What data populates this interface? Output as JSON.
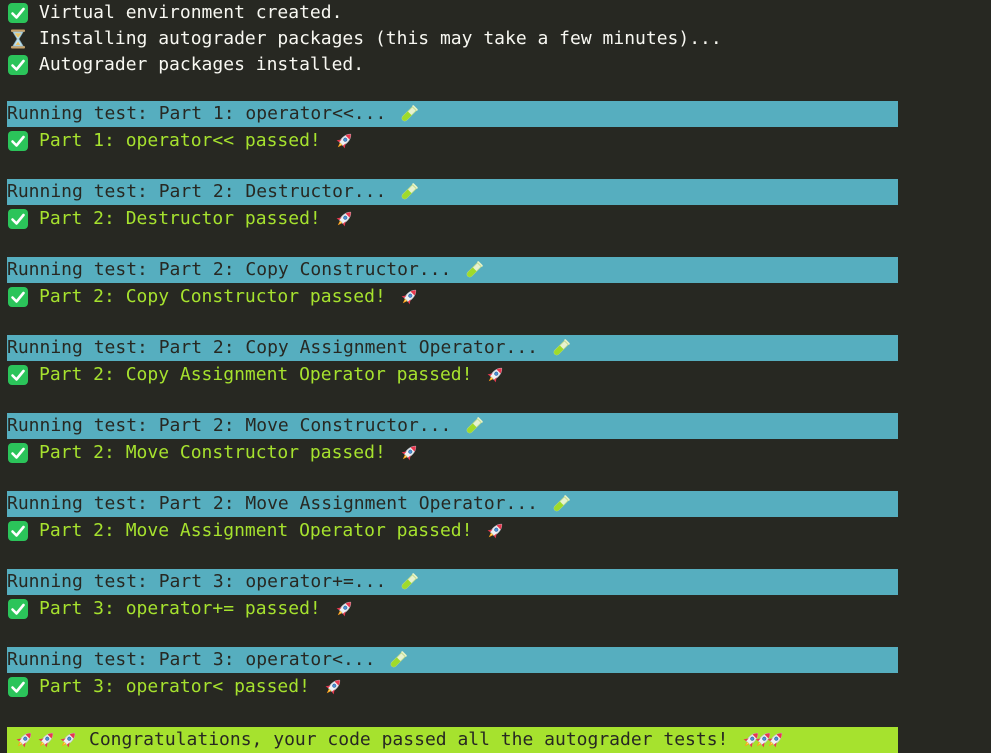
{
  "status": [
    {
      "icon": "check-icon",
      "text": "Virtual environment created."
    },
    {
      "icon": "hourglass-icon",
      "text": "Installing autograder packages (this may take a few minutes)..."
    },
    {
      "icon": "check-icon",
      "text": "Autograder packages installed."
    }
  ],
  "tests": [
    {
      "running": "Running test: Part 1: operator<<...",
      "passed": "Part 1: operator<< passed!"
    },
    {
      "running": "Running test: Part 2: Destructor...",
      "passed": "Part 2: Destructor passed!"
    },
    {
      "running": "Running test: Part 2: Copy Constructor...",
      "passed": "Part 2: Copy Constructor passed!"
    },
    {
      "running": "Running test: Part 2: Copy Assignment Operator...",
      "passed": "Part 2: Copy Assignment Operator passed!"
    },
    {
      "running": "Running test: Part 2: Move Constructor...",
      "passed": "Part 2: Move Constructor passed!"
    },
    {
      "running": "Running test: Part 2: Move Assignment Operator...",
      "passed": "Part 2: Move Assignment Operator passed!"
    },
    {
      "running": "Running test: Part 3: operator+=...",
      "passed": "Part 3: operator+= passed!"
    },
    {
      "running": "Running test: Part 3: operator<...",
      "passed": "Part 3: operator< passed!"
    }
  ],
  "final": {
    "text": "Congratulations, your code passed all the autograder tests!"
  },
  "icons": {
    "running": "test-tube-icon",
    "passed": "rocket-icon",
    "check": "check-icon"
  },
  "colors": {
    "background": "#272822",
    "text": "#f8f8f2",
    "running_band": "#56aebf",
    "pass_text": "#a6e22e",
    "final_band": "#a6e22e",
    "check_green": "#2bc45a"
  }
}
